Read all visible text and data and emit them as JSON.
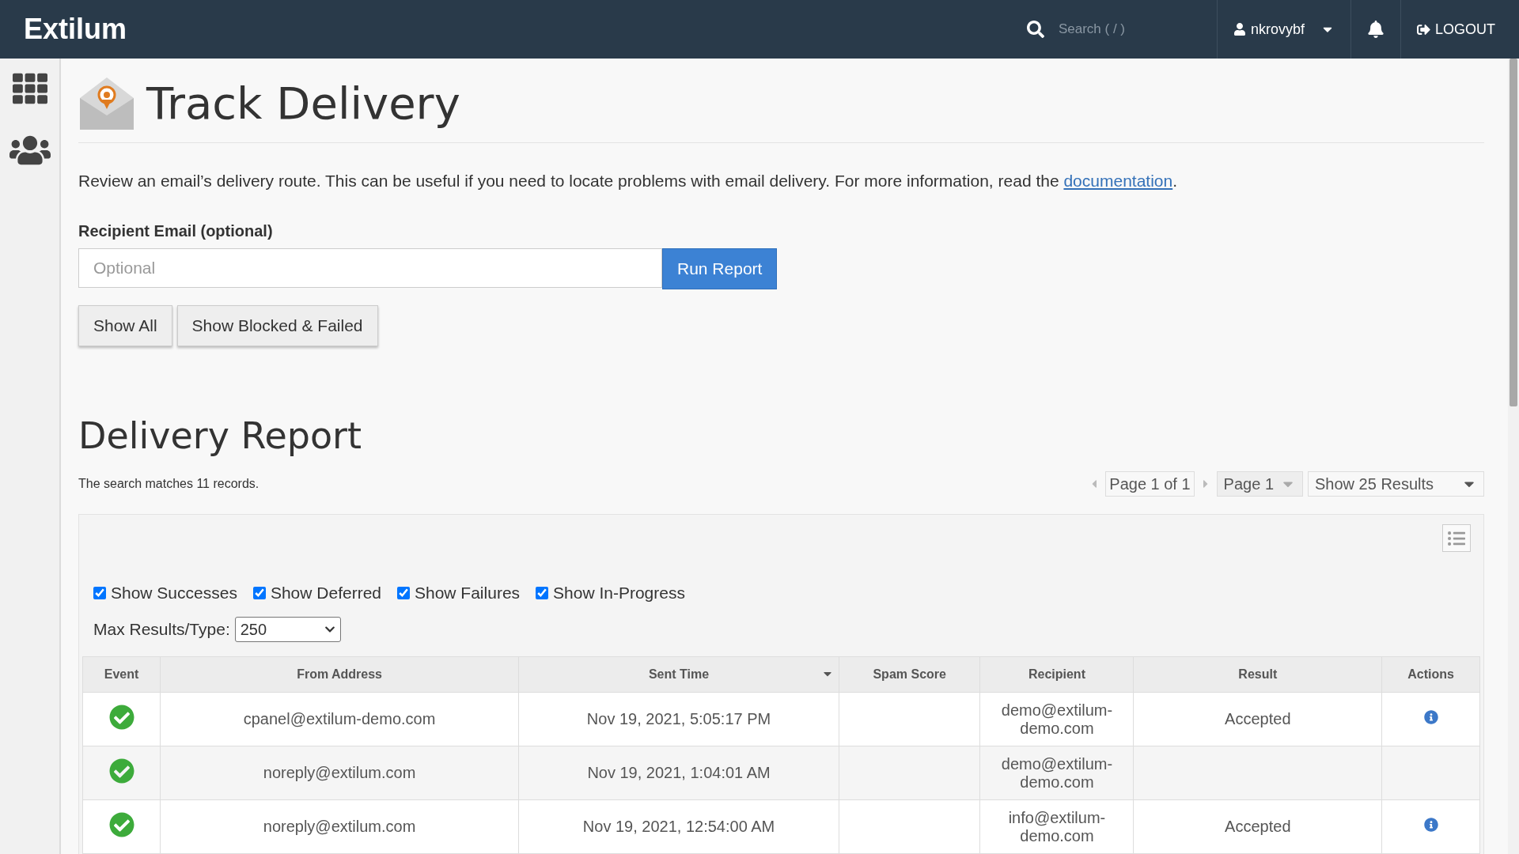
{
  "topbar": {
    "brand": "Extilum",
    "search_placeholder": "Search ( / )",
    "user": "nkrovybf",
    "logout": "LOGOUT"
  },
  "page": {
    "title": "Track Delivery",
    "intro": "Review an email’s delivery route. This can be useful if you need to locate problems with email delivery. For more information, read the ",
    "intro_link": "documentation",
    "intro_end": "."
  },
  "recipient": {
    "label": "Recipient Email (optional)",
    "placeholder": "Optional",
    "run": "Run Report"
  },
  "filters": [
    "Show All",
    "Show Blocked & Failed"
  ],
  "report": {
    "title": "Delivery Report",
    "matches": "The search matches 11 records.",
    "page_info": "Page 1 of 1",
    "page_select": "Page 1",
    "results_select": "Show 25 Results"
  },
  "checkboxes": [
    {
      "label": "Show Successes",
      "checked": true
    },
    {
      "label": "Show Deferred",
      "checked": true
    },
    {
      "label": "Show Failures",
      "checked": true
    },
    {
      "label": "Show In-Progress",
      "checked": true
    }
  ],
  "max_results": {
    "label": "Max Results/Type:",
    "value": "250"
  },
  "table": {
    "columns": [
      {
        "label": "Event",
        "sorted": false
      },
      {
        "label": "From Address",
        "sorted": false
      },
      {
        "label": "Sent Time",
        "sorted": true
      },
      {
        "label": "Spam Score",
        "sorted": false
      },
      {
        "label": "Recipient",
        "sorted": false
      },
      {
        "label": "Result",
        "sorted": false
      },
      {
        "label": "Actions",
        "sorted": false
      }
    ],
    "rows": [
      {
        "kind": "success",
        "from": "cpanel@extilum-demo.com",
        "sent": "Nov 19, 2021, 5:05:17 PM",
        "recipient": "demo@extilum-demo.com",
        "result": "Accepted",
        "info": true
      },
      {
        "kind": "success",
        "from": "noreply@extilum.com",
        "sent": "Nov 19, 2021, 1:04:01 AM",
        "recipient": "demo@extilum-demo.com",
        "info": false
      },
      {
        "kind": "success",
        "from": "noreply@extilum.com",
        "sent": "Nov 19, 2021, 12:54:00 AM",
        "recipient": "info@extilum-demo.com",
        "result": "Accepted",
        "info": true
      }
    ]
  }
}
